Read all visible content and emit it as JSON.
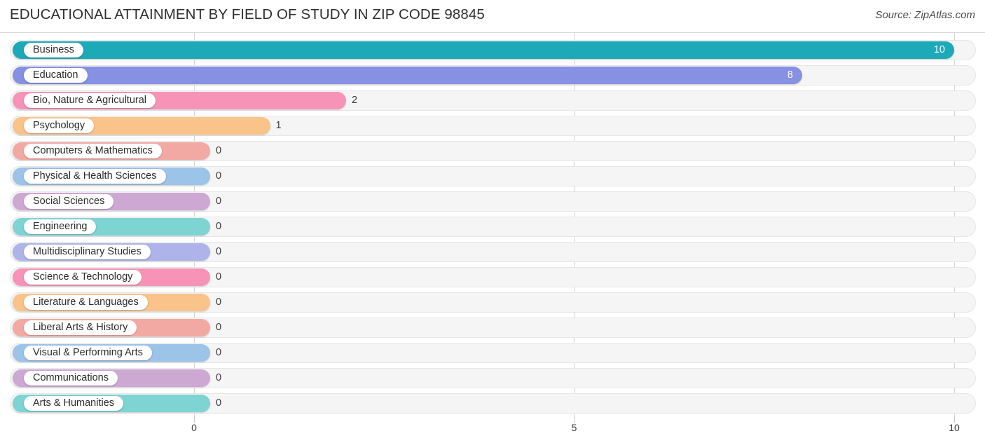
{
  "header": {
    "title": "EDUCATIONAL ATTAINMENT BY FIELD OF STUDY IN ZIP CODE 98845",
    "source": "Source: ZipAtlas.com"
  },
  "chart_data": {
    "type": "bar",
    "orientation": "horizontal",
    "title": "EDUCATIONAL ATTAINMENT BY FIELD OF STUDY IN ZIP CODE 98845",
    "xlabel": "",
    "ylabel": "",
    "xlim": [
      0,
      10
    ],
    "grid": true,
    "legend": "none",
    "xticks": [
      "0",
      "5",
      "10"
    ],
    "xtick_values": [
      0,
      5,
      10
    ],
    "categories": [
      "Business",
      "Education",
      "Bio, Nature & Agricultural",
      "Psychology",
      "Computers & Mathematics",
      "Physical & Health Sciences",
      "Social Sciences",
      "Engineering",
      "Multidisciplinary Studies",
      "Science & Technology",
      "Literature & Languages",
      "Liberal Arts & History",
      "Visual & Performing Arts",
      "Communications",
      "Arts & Humanities"
    ],
    "values": [
      10,
      8,
      2,
      1,
      0,
      0,
      0,
      0,
      0,
      0,
      0,
      0,
      0,
      0,
      0
    ],
    "value_labels": [
      "10",
      "8",
      "2",
      "1",
      "0",
      "0",
      "0",
      "0",
      "0",
      "0",
      "0",
      "0",
      "0",
      "0",
      "0"
    ],
    "colors": [
      "#1ca9b8",
      "#8691e3",
      "#f893b8",
      "#f9c38a",
      "#f2a9a4",
      "#9cc3e8",
      "#cda8d3",
      "#7ed3d3",
      "#aeb4ea",
      "#f893b8",
      "#f9c38a",
      "#f2a9a4",
      "#9cc3e8",
      "#cda8d3",
      "#7ed3d3"
    ]
  }
}
